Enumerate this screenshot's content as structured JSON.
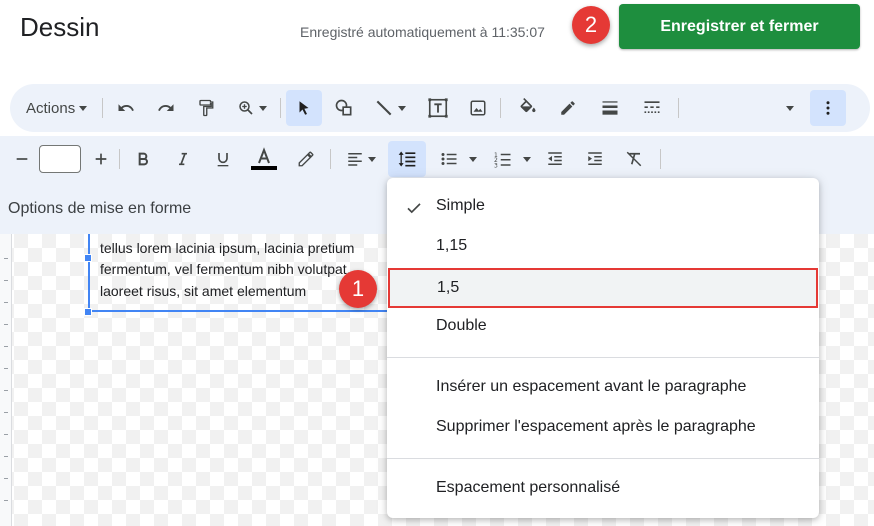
{
  "header": {
    "title": "Dessin",
    "autosave": "Enregistré automatiquement à 11:35:07",
    "save_button": "Enregistrer et fermer"
  },
  "callouts": [
    "1",
    "2"
  ],
  "toolbar1": {
    "actions_label": "Actions",
    "icons": [
      "undo-icon",
      "redo-icon",
      "paint-format-icon",
      "zoom-icon",
      "select-icon",
      "shape-icon",
      "line-icon",
      "textbox-icon",
      "image-icon",
      "fill-color-icon",
      "border-color-icon",
      "border-weight-icon",
      "border-dash-icon",
      "more-icon"
    ]
  },
  "toolbar2": {
    "font_size": "",
    "icons": [
      "decrease-font-icon",
      "increase-font-icon",
      "bold-icon",
      "italic-icon",
      "underline-icon",
      "text-color-icon",
      "highlight-icon",
      "align-icon",
      "line-spacing-icon",
      "bulleted-list-icon",
      "numbered-list-icon",
      "decrease-indent-icon",
      "increase-indent-icon",
      "clear-formatting-icon"
    ]
  },
  "options_label": "Options de mise en forme",
  "canvas": {
    "text_lines": [
      "tellus lorem lacinia ipsum, lacinia pretium",
      "fermentum, vel fermentum nibh volutpat.",
      "laoreet risus, sit amet elementum"
    ]
  },
  "line_spacing_menu": {
    "items": [
      {
        "label": "Simple",
        "checked": true
      },
      {
        "label": "1,15",
        "checked": false
      },
      {
        "label": "1,5",
        "checked": false,
        "highlighted": true
      },
      {
        "label": "Double",
        "checked": false
      },
      {
        "label": "Insérer un espacement avant le paragraphe",
        "checked": false
      },
      {
        "label": "Supprimer l'espacement après le paragraphe",
        "checked": false
      },
      {
        "label": "Espacement personnalisé",
        "checked": false
      }
    ]
  },
  "colors": {
    "accent_green": "#1e8e3e",
    "callout_red": "#e53935",
    "toolbar_bg": "#edf2fa",
    "selection_blue": "#4285f4"
  }
}
